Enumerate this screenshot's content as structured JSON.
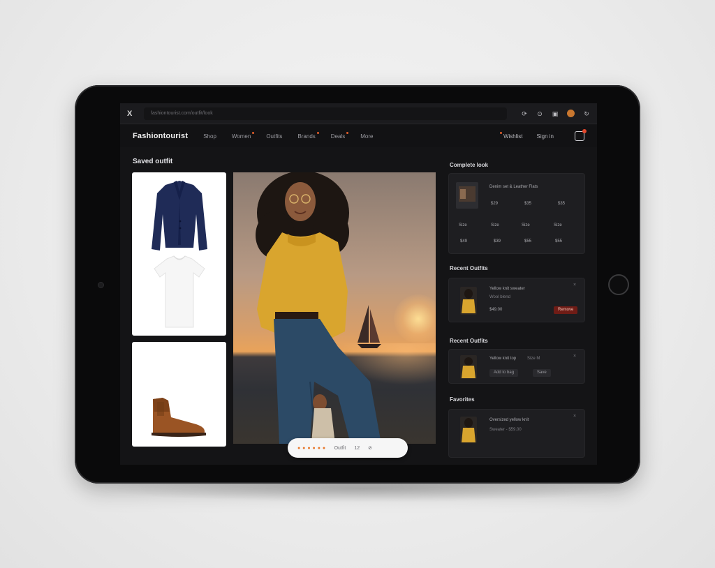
{
  "browser": {
    "logo": "X",
    "url": "fashiontourist.com/outfit/look",
    "icons": [
      "share-icon",
      "bookmark-icon",
      "tab-icon",
      "avatar",
      "refresh-icon"
    ]
  },
  "nav": {
    "brand": "Fashiontourist",
    "links": [
      "Shop",
      "Women",
      "Outfits",
      "Brands",
      "Deals",
      "More"
    ],
    "right_links": [
      "Wishlist",
      "Sign in"
    ]
  },
  "main": {
    "section_title": "Saved outfit"
  },
  "right_column": {
    "complete_look": {
      "title": "Complete look",
      "item_name": "Denim set & Leather Flats",
      "row1": [
        "$29",
        "$35",
        "$35"
      ],
      "row2": [
        "Size",
        "Size",
        "Size",
        "Size"
      ],
      "row3": [
        "$49",
        "$39",
        "$55",
        "$55"
      ]
    },
    "card2": {
      "title": "Recent Outfits",
      "item_name": "Yellow knit sweater",
      "item_sub": "Wool blend",
      "price": "$49.00",
      "button": "Remove"
    },
    "card3": {
      "title": "Recent Outfits",
      "item_name": "Yellow knit top",
      "item_sub": "Size M",
      "btn1": "Add to bag",
      "btn2": "Save"
    },
    "card4": {
      "title": "Favorites",
      "item_name": "Oversized yellow knit",
      "item_sub": "Sweater - $59.00"
    }
  },
  "floating_bar": {
    "rating": "● ● ● ● ● ●",
    "label": "Outfit",
    "count": "12"
  },
  "colors": {
    "accent": "#e8792d",
    "danger": "#6f1c16"
  }
}
